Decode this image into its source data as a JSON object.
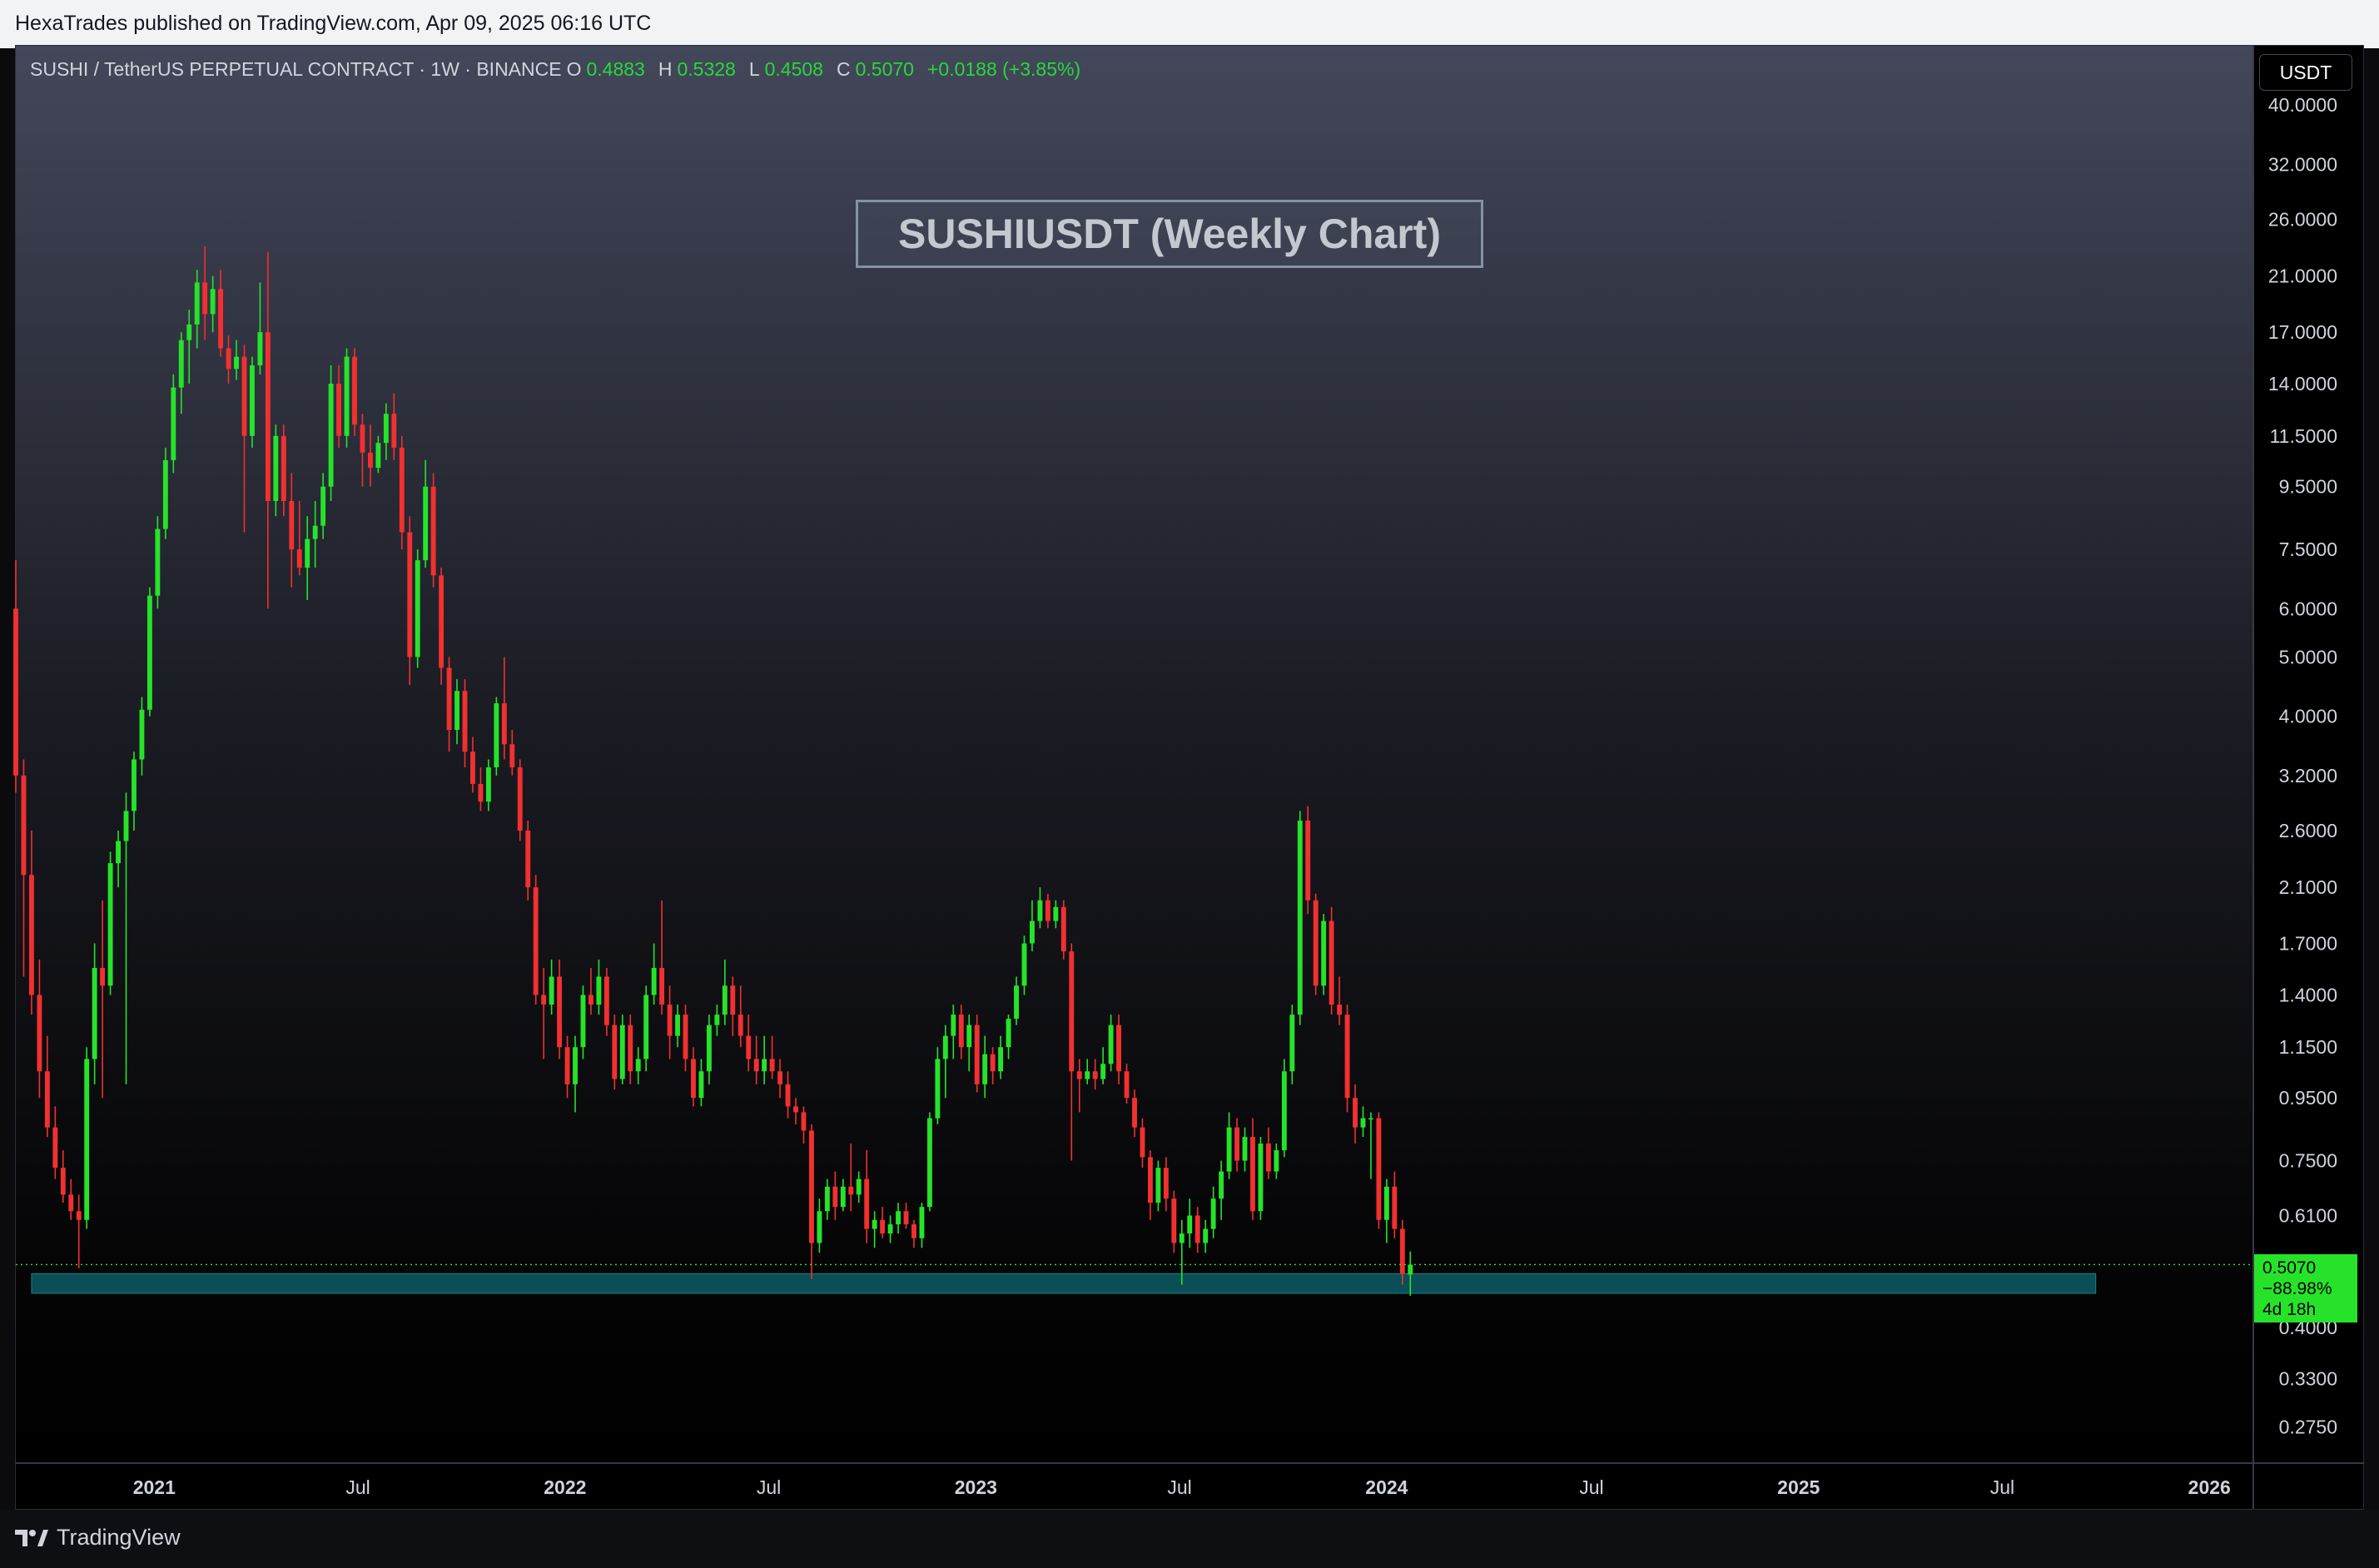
{
  "header": {
    "published_text": "HexaTrades published on TradingView.com, Apr 09, 2025 06:16 UTC"
  },
  "legend": {
    "symbol": "SUSHI / TetherUS PERPETUAL CONTRACT · 1W · BINANCE",
    "open_label": "O",
    "open_value": "0.4883",
    "high_label": "H",
    "high_value": "0.5328",
    "low_label": "L",
    "low_value": "0.4508",
    "close_label": "C",
    "close_value": "0.5070",
    "change": "+0.0188 (+3.85%)"
  },
  "currency_button": "USDT",
  "chart_title": "SUSHIUSDT (Weekly Chart)",
  "price_label": {
    "price": "0.5070",
    "change_pct": "−88.98%",
    "countdown": "4d 18h"
  },
  "footer": {
    "brand": "TradingView"
  },
  "colors": {
    "up": "#26e32a",
    "down": "#f23030",
    "zone": "#0a4f55",
    "accent": "#26e32a"
  },
  "chart_data": {
    "type": "candlestick",
    "interval": "weekly",
    "title": "SUSHIUSDT (Weekly Chart)",
    "y_scale": "log",
    "y_range": [
      0.24,
      50
    ],
    "y_ticks": [
      "40.0000",
      "32.0000",
      "26.0000",
      "21.0000",
      "17.0000",
      "14.0000",
      "11.5000",
      "9.5000",
      "7.5000",
      "6.0000",
      "5.0000",
      "4.0000",
      "3.2000",
      "2.6000",
      "2.1000",
      "1.7000",
      "1.4000",
      "1.1500",
      "0.9500",
      "0.7500",
      "0.6100",
      "0.4000",
      "0.3300",
      "0.2750"
    ],
    "x_range": [
      "2020-08-31",
      "2026-02-09"
    ],
    "x_ticks": [
      {
        "label": "2021",
        "date": "2021-01-01",
        "bold": true
      },
      {
        "label": "Jul",
        "date": "2021-07-01",
        "bold": false
      },
      {
        "label": "2022",
        "date": "2022-01-01",
        "bold": true
      },
      {
        "label": "Jul",
        "date": "2022-07-01",
        "bold": false
      },
      {
        "label": "2023",
        "date": "2023-01-01",
        "bold": true
      },
      {
        "label": "Jul",
        "date": "2023-07-01",
        "bold": false
      },
      {
        "label": "2024",
        "date": "2024-01-01",
        "bold": true
      },
      {
        "label": "Jul",
        "date": "2024-07-01",
        "bold": false
      },
      {
        "label": "2025",
        "date": "2025-01-01",
        "bold": true
      },
      {
        "label": "Jul",
        "date": "2025-07-01",
        "bold": false
      },
      {
        "label": "2026",
        "date": "2026-01-01",
        "bold": true
      }
    ],
    "current_price": 0.507,
    "support_zone": {
      "from": 0.455,
      "to": 0.49,
      "start": "2020-09-14",
      "end": "2025-09-22"
    },
    "start_date": "2020-08-31",
    "candles": [
      [
        6.0,
        7.2,
        3.0,
        3.2
      ],
      [
        3.2,
        3.4,
        1.5,
        2.2
      ],
      [
        2.2,
        2.6,
        1.3,
        1.4
      ],
      [
        1.4,
        1.6,
        0.95,
        1.05
      ],
      [
        1.05,
        1.2,
        0.82,
        0.85
      ],
      [
        0.85,
        0.92,
        0.7,
        0.73
      ],
      [
        0.73,
        0.78,
        0.64,
        0.66
      ],
      [
        0.66,
        0.7,
        0.6,
        0.62
      ],
      [
        0.62,
        0.66,
        0.5,
        0.6
      ],
      [
        0.6,
        1.15,
        0.58,
        1.1
      ],
      [
        1.1,
        1.7,
        1.0,
        1.55
      ],
      [
        1.55,
        2.0,
        0.95,
        1.45
      ],
      [
        1.45,
        2.4,
        1.4,
        2.3
      ],
      [
        2.3,
        2.6,
        2.1,
        2.5
      ],
      [
        2.5,
        3.0,
        1.0,
        2.8
      ],
      [
        2.8,
        3.5,
        2.6,
        3.4
      ],
      [
        3.4,
        4.3,
        3.2,
        4.1
      ],
      [
        4.1,
        6.5,
        4.0,
        6.3
      ],
      [
        6.3,
        8.5,
        6.0,
        8.1
      ],
      [
        8.1,
        11.0,
        7.8,
        10.5
      ],
      [
        10.5,
        14.5,
        10.0,
        13.8
      ],
      [
        13.8,
        17.0,
        12.5,
        16.5
      ],
      [
        16.5,
        18.5,
        14.0,
        17.5
      ],
      [
        17.5,
        21.5,
        16.0,
        20.5
      ],
      [
        20.5,
        23.5,
        16.5,
        18.2
      ],
      [
        18.2,
        21.0,
        17.0,
        20.0
      ],
      [
        20.0,
        21.5,
        15.5,
        16.0
      ],
      [
        16.0,
        16.8,
        14.0,
        14.8
      ],
      [
        14.8,
        16.5,
        14.2,
        15.5
      ],
      [
        15.5,
        16.2,
        8.0,
        11.5
      ],
      [
        11.5,
        15.5,
        11.0,
        15.0
      ],
      [
        15.0,
        20.5,
        14.5,
        17.0
      ],
      [
        17.0,
        23.0,
        6.0,
        9.0
      ],
      [
        9.0,
        12.0,
        8.5,
        11.5
      ],
      [
        11.5,
        12.0,
        8.5,
        9.0
      ],
      [
        9.0,
        10.0,
        6.5,
        7.5
      ],
      [
        7.5,
        9.0,
        6.8,
        7.0
      ],
      [
        7.0,
        8.5,
        6.2,
        7.8
      ],
      [
        7.8,
        9.0,
        7.0,
        8.2
      ],
      [
        8.2,
        10.0,
        7.8,
        9.5
      ],
      [
        9.5,
        15.0,
        9.0,
        14.0
      ],
      [
        14.0,
        15.0,
        11.0,
        11.5
      ],
      [
        11.5,
        16.0,
        11.0,
        15.5
      ],
      [
        15.5,
        16.0,
        11.5,
        12.0
      ],
      [
        12.0,
        12.5,
        9.5,
        10.8
      ],
      [
        10.8,
        12.0,
        9.5,
        10.2
      ],
      [
        10.2,
        11.5,
        10.0,
        11.2
      ],
      [
        11.2,
        13.0,
        10.5,
        12.5
      ],
      [
        12.5,
        13.5,
        10.5,
        11.0
      ],
      [
        11.0,
        11.5,
        7.5,
        8.0
      ],
      [
        8.0,
        8.5,
        4.5,
        5.0
      ],
      [
        5.0,
        7.5,
        4.8,
        7.2
      ],
      [
        7.2,
        10.5,
        7.0,
        9.5
      ],
      [
        9.5,
        10.0,
        6.5,
        6.8
      ],
      [
        6.8,
        7.0,
        4.5,
        4.8
      ],
      [
        4.8,
        5.0,
        3.5,
        3.8
      ],
      [
        3.8,
        4.6,
        3.6,
        4.4
      ],
      [
        4.4,
        4.6,
        3.3,
        3.5
      ],
      [
        3.5,
        3.7,
        3.0,
        3.1
      ],
      [
        3.1,
        3.3,
        2.8,
        2.9
      ],
      [
        2.9,
        3.4,
        2.8,
        3.3
      ],
      [
        3.3,
        4.3,
        3.2,
        4.2
      ],
      [
        4.2,
        5.0,
        3.4,
        3.6
      ],
      [
        3.6,
        3.8,
        3.2,
        3.3
      ],
      [
        3.3,
        3.4,
        2.5,
        2.6
      ],
      [
        2.6,
        2.7,
        2.0,
        2.1
      ],
      [
        2.1,
        2.2,
        1.35,
        1.4
      ],
      [
        1.4,
        1.55,
        1.1,
        1.35
      ],
      [
        1.35,
        1.6,
        1.3,
        1.5
      ],
      [
        1.5,
        1.6,
        1.1,
        1.15
      ],
      [
        1.15,
        1.2,
        0.95,
        1.0
      ],
      [
        1.0,
        1.2,
        0.9,
        1.15
      ],
      [
        1.15,
        1.45,
        1.1,
        1.4
      ],
      [
        1.4,
        1.55,
        1.3,
        1.35
      ],
      [
        1.35,
        1.6,
        1.3,
        1.5
      ],
      [
        1.5,
        1.55,
        1.2,
        1.25
      ],
      [
        1.25,
        1.3,
        0.98,
        1.02
      ],
      [
        1.02,
        1.3,
        1.0,
        1.25
      ],
      [
        1.25,
        1.3,
        1.0,
        1.05
      ],
      [
        1.05,
        1.15,
        1.0,
        1.1
      ],
      [
        1.1,
        1.45,
        1.05,
        1.4
      ],
      [
        1.4,
        1.7,
        1.35,
        1.55
      ],
      [
        1.55,
        2.0,
        1.3,
        1.35
      ],
      [
        1.35,
        1.45,
        1.1,
        1.2
      ],
      [
        1.2,
        1.35,
        1.15,
        1.3
      ],
      [
        1.3,
        1.35,
        1.05,
        1.1
      ],
      [
        1.1,
        1.15,
        0.92,
        0.95
      ],
      [
        0.95,
        1.1,
        0.92,
        1.05
      ],
      [
        1.05,
        1.3,
        1.0,
        1.25
      ],
      [
        1.25,
        1.35,
        1.2,
        1.3
      ],
      [
        1.3,
        1.6,
        1.25,
        1.45
      ],
      [
        1.45,
        1.5,
        1.2,
        1.3
      ],
      [
        1.3,
        1.45,
        1.15,
        1.2
      ],
      [
        1.2,
        1.3,
        1.05,
        1.1
      ],
      [
        1.1,
        1.2,
        1.0,
        1.05
      ],
      [
        1.05,
        1.2,
        1.0,
        1.1
      ],
      [
        1.1,
        1.2,
        1.02,
        1.05
      ],
      [
        1.05,
        1.1,
        0.95,
        1.0
      ],
      [
        1.0,
        1.05,
        0.88,
        0.92
      ],
      [
        0.92,
        0.95,
        0.86,
        0.9
      ],
      [
        0.9,
        0.92,
        0.8,
        0.84
      ],
      [
        0.84,
        0.86,
        0.48,
        0.55
      ],
      [
        0.55,
        0.65,
        0.53,
        0.62
      ],
      [
        0.62,
        0.7,
        0.6,
        0.68
      ],
      [
        0.68,
        0.72,
        0.6,
        0.63
      ],
      [
        0.63,
        0.7,
        0.62,
        0.68
      ],
      [
        0.68,
        0.8,
        0.62,
        0.66
      ],
      [
        0.66,
        0.72,
        0.64,
        0.7
      ],
      [
        0.7,
        0.78,
        0.55,
        0.58
      ],
      [
        0.58,
        0.62,
        0.54,
        0.6
      ],
      [
        0.6,
        0.63,
        0.56,
        0.57
      ],
      [
        0.57,
        0.61,
        0.55,
        0.59
      ],
      [
        0.59,
        0.64,
        0.57,
        0.62
      ],
      [
        0.62,
        0.64,
        0.58,
        0.59
      ],
      [
        0.59,
        0.6,
        0.54,
        0.56
      ],
      [
        0.56,
        0.64,
        0.54,
        0.63
      ],
      [
        0.63,
        0.9,
        0.62,
        0.88
      ],
      [
        0.88,
        1.15,
        0.86,
        1.1
      ],
      [
        1.1,
        1.25,
        0.95,
        1.2
      ],
      [
        1.2,
        1.35,
        1.1,
        1.3
      ],
      [
        1.3,
        1.35,
        1.1,
        1.15
      ],
      [
        1.15,
        1.3,
        1.05,
        1.25
      ],
      [
        1.25,
        1.3,
        0.97,
        1.0
      ],
      [
        1.0,
        1.2,
        0.95,
        1.12
      ],
      [
        1.12,
        1.15,
        1.0,
        1.05
      ],
      [
        1.05,
        1.2,
        1.02,
        1.15
      ],
      [
        1.15,
        1.3,
        1.1,
        1.28
      ],
      [
        1.28,
        1.5,
        1.25,
        1.45
      ],
      [
        1.45,
        1.75,
        1.4,
        1.7
      ],
      [
        1.7,
        2.0,
        1.65,
        1.85
      ],
      [
        1.85,
        2.1,
        1.8,
        2.0
      ],
      [
        2.0,
        2.05,
        1.8,
        1.85
      ],
      [
        1.85,
        2.0,
        1.8,
        1.95
      ],
      [
        1.95,
        2.0,
        1.6,
        1.65
      ],
      [
        1.65,
        1.7,
        0.75,
        1.05
      ],
      [
        1.05,
        1.1,
        0.9,
        1.02
      ],
      [
        1.02,
        1.1,
        1.0,
        1.05
      ],
      [
        1.05,
        1.1,
        0.98,
        1.02
      ],
      [
        1.02,
        1.15,
        1.0,
        1.08
      ],
      [
        1.08,
        1.3,
        1.05,
        1.25
      ],
      [
        1.25,
        1.3,
        1.0,
        1.05
      ],
      [
        1.05,
        1.08,
        0.93,
        0.95
      ],
      [
        0.95,
        0.98,
        0.82,
        0.85
      ],
      [
        0.85,
        0.88,
        0.73,
        0.76
      ],
      [
        0.76,
        0.78,
        0.6,
        0.64
      ],
      [
        0.64,
        0.75,
        0.62,
        0.73
      ],
      [
        0.73,
        0.76,
        0.62,
        0.65
      ],
      [
        0.65,
        0.67,
        0.53,
        0.55
      ],
      [
        0.55,
        0.6,
        0.47,
        0.57
      ],
      [
        0.57,
        0.65,
        0.54,
        0.61
      ],
      [
        0.61,
        0.63,
        0.53,
        0.55
      ],
      [
        0.55,
        0.6,
        0.53,
        0.58
      ],
      [
        0.58,
        0.68,
        0.56,
        0.65
      ],
      [
        0.65,
        0.75,
        0.6,
        0.72
      ],
      [
        0.72,
        0.9,
        0.7,
        0.85
      ],
      [
        0.85,
        0.88,
        0.72,
        0.75
      ],
      [
        0.75,
        0.85,
        0.72,
        0.82
      ],
      [
        0.82,
        0.88,
        0.6,
        0.62
      ],
      [
        0.62,
        0.82,
        0.6,
        0.8
      ],
      [
        0.8,
        0.85,
        0.7,
        0.72
      ],
      [
        0.72,
        0.8,
        0.7,
        0.78
      ],
      [
        0.78,
        1.1,
        0.76,
        1.05
      ],
      [
        1.05,
        1.35,
        1.0,
        1.3
      ],
      [
        1.3,
        2.8,
        1.25,
        2.7
      ],
      [
        2.7,
        2.85,
        1.9,
        2.0
      ],
      [
        2.0,
        2.05,
        1.4,
        1.45
      ],
      [
        1.45,
        1.9,
        1.4,
        1.85
      ],
      [
        1.85,
        1.95,
        1.3,
        1.35
      ],
      [
        1.35,
        1.5,
        1.25,
        1.3
      ],
      [
        1.3,
        1.35,
        0.9,
        0.95
      ],
      [
        0.95,
        1.0,
        0.8,
        0.85
      ],
      [
        0.85,
        0.92,
        0.82,
        0.88
      ],
      [
        0.88,
        0.9,
        0.7,
        0.88
      ],
      [
        0.88,
        0.9,
        0.58,
        0.6
      ],
      [
        0.6,
        0.7,
        0.55,
        0.68
      ],
      [
        0.68,
        0.72,
        0.56,
        0.58
      ],
      [
        0.58,
        0.6,
        0.47,
        0.49
      ],
      [
        0.4883,
        0.5328,
        0.4508,
        0.507
      ]
    ]
  }
}
